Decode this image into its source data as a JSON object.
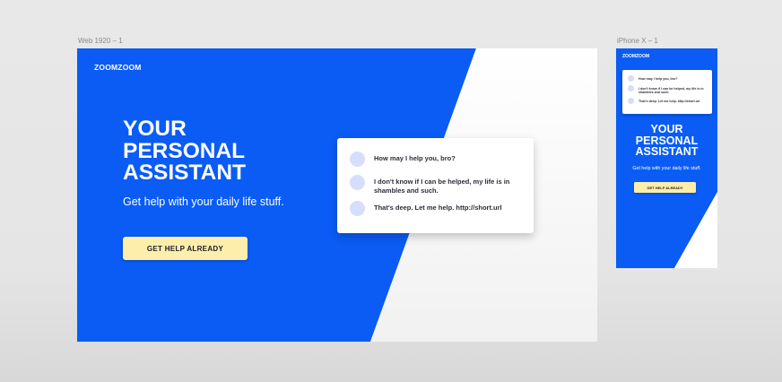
{
  "frames": {
    "web_label": "Web 1920 – 1",
    "phone_label": "iPhone X – 1"
  },
  "colors": {
    "brand_blue": "#0a5cf5",
    "cta_yellow": "#fdeeab",
    "avatar": "#d6defc"
  },
  "web": {
    "logo": "ZOOMZOOM",
    "hero_title": [
      "YOUR",
      "PERSONAL",
      "ASSISTANT"
    ],
    "subtitle": "Get help with your daily life stuff.",
    "cta_label": "GET HELP ALREADY",
    "chat": [
      "How may I help you, bro?",
      "I don't know if I can be helped, my life is in shambles and such.",
      "That's deep. Let me help. http://short.url"
    ]
  },
  "phone": {
    "logo": "ZOOMZOOM",
    "hero_title": [
      "YOUR",
      "PERSONAL",
      "ASSISTANT"
    ],
    "subtitle": "Get help with your daily life stuff.",
    "cta_label": "GET HELP ALREADY",
    "chat": [
      "How may I help you, bro?",
      "I don't know if I can be helped, my life is in shambles and such.",
      "That's deep. Let me help. http://short.url"
    ]
  }
}
